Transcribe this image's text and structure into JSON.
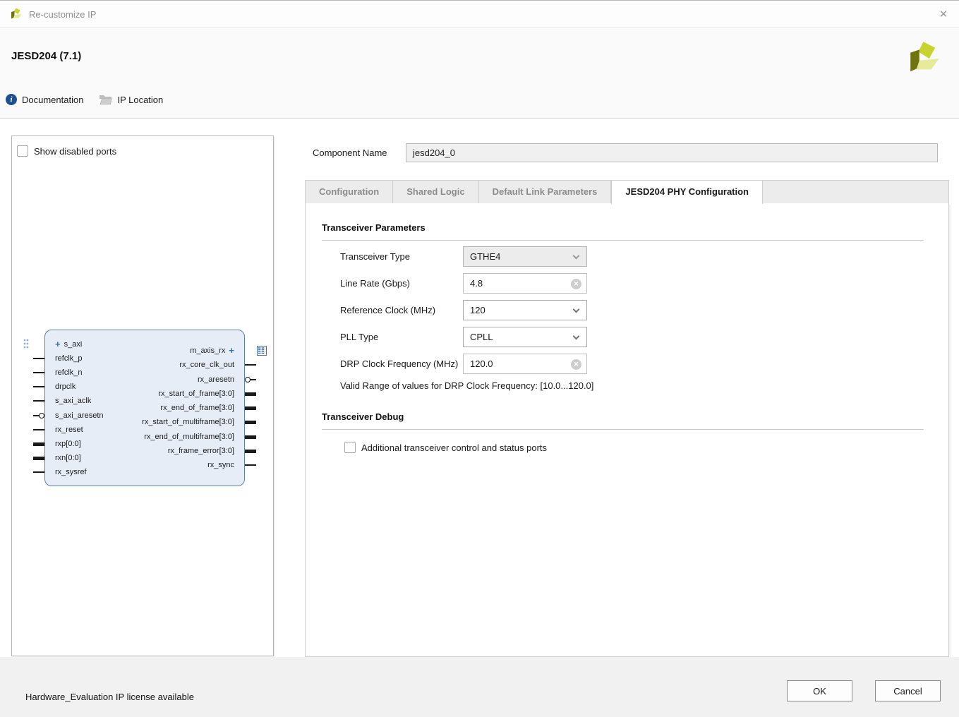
{
  "titlebar": {
    "title": "Re-customize IP"
  },
  "icons": {
    "close": "✕",
    "info": "i"
  },
  "header": {
    "ip_title": "JESD204 (7.1)"
  },
  "toolbar": {
    "documentation": "Documentation",
    "ip_location": "IP Location"
  },
  "left_panel": {
    "show_disabled_ports": "Show disabled ports",
    "block": {
      "left_ports": [
        {
          "label": "s_axi",
          "kind": "interface",
          "adorn": "grip-dots"
        },
        {
          "label": "refclk_p",
          "kind": "wire"
        },
        {
          "label": "refclk_n",
          "kind": "wire"
        },
        {
          "label": "drpclk",
          "kind": "wire"
        },
        {
          "label": "s_axi_aclk",
          "kind": "wire"
        },
        {
          "label": "s_axi_aresetn",
          "kind": "reset"
        },
        {
          "label": "rx_reset",
          "kind": "wire"
        },
        {
          "label": "rxp[0:0]",
          "kind": "bus"
        },
        {
          "label": "rxn[0:0]",
          "kind": "bus"
        },
        {
          "label": "rx_sysref",
          "kind": "wire"
        }
      ],
      "right_ports": [
        {
          "label": "m_axis_rx",
          "kind": "interface",
          "adorn": "stream-grid"
        },
        {
          "label": "rx_core_clk_out",
          "kind": "wire"
        },
        {
          "label": "rx_aresetn",
          "kind": "reset"
        },
        {
          "label": "rx_start_of_frame[3:0]",
          "kind": "bus"
        },
        {
          "label": "rx_end_of_frame[3:0]",
          "kind": "bus"
        },
        {
          "label": "rx_start_of_multiframe[3:0]",
          "kind": "bus"
        },
        {
          "label": "rx_end_of_multiframe[3:0]",
          "kind": "bus"
        },
        {
          "label": "rx_frame_error[3:0]",
          "kind": "bus"
        },
        {
          "label": "rx_sync",
          "kind": "wire"
        }
      ]
    }
  },
  "component": {
    "label": "Component Name",
    "value": "jesd204_0"
  },
  "tabs": [
    {
      "label": "Configuration",
      "active": false
    },
    {
      "label": "Shared Logic",
      "active": false
    },
    {
      "label": "Default Link Parameters",
      "active": false
    },
    {
      "label": "JESD204 PHY Configuration",
      "active": true
    }
  ],
  "form": {
    "section1_title": "Transceiver Parameters",
    "fields": [
      {
        "label": "Transceiver Type",
        "value": "GTHE4",
        "control": "select",
        "disabled": true
      },
      {
        "label": "Line Rate (Gbps)",
        "value": "4.8",
        "control": "text",
        "clearable": true
      },
      {
        "label": "Reference Clock (MHz)",
        "value": "120",
        "control": "select",
        "disabled": false
      },
      {
        "label": "PLL Type",
        "value": "CPLL",
        "control": "select",
        "disabled": false
      },
      {
        "label": "DRP Clock Frequency (MHz)",
        "value": "120.0",
        "control": "text",
        "clearable": true
      }
    ],
    "note": "Valid Range of values for DRP Clock Frequency: [10.0...120.0]",
    "section2_title": "Transceiver Debug",
    "debug_checkbox_label": "Additional transceiver control and status ports"
  },
  "footer": {
    "license_text": "Hardware_Evaluation IP license available",
    "ok_label": "OK",
    "cancel_label": "Cancel"
  },
  "colors": {
    "accent_blue": "#2e6db4",
    "block_fill": "#e7edf7",
    "block_border": "#5e81ac",
    "info_icon": "#1d5091",
    "logo_dark": "#6f7410",
    "logo_bright": "#c9d32f",
    "logo_pale": "#e7e99b"
  }
}
